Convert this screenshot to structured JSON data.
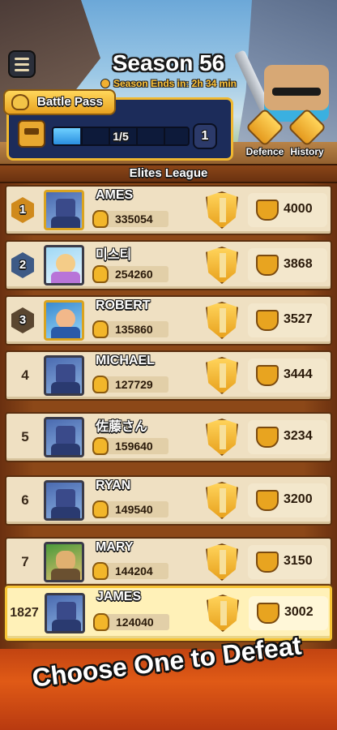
{
  "header": {
    "season_title": "Season 56",
    "season_ends": "Season Ends in: 2h 34 min",
    "menu_icon": "hamburger-menu-icon"
  },
  "battle_pass": {
    "label": "Battle Pass",
    "progress_text": "1/5",
    "progress_fraction": 0.2,
    "level": "1"
  },
  "side_buttons": {
    "defence": "Defence",
    "history": "History"
  },
  "league": {
    "title": "Elites League"
  },
  "rows": [
    {
      "rank": "1",
      "name": "AMES",
      "score": "335054",
      "trophies": "4000"
    },
    {
      "rank": "2",
      "name": "미스티",
      "score": "254260",
      "trophies": "3868"
    },
    {
      "rank": "3",
      "name": "ROBERT",
      "score": "135860",
      "trophies": "3527"
    },
    {
      "rank": "4",
      "name": "MICHAEL",
      "score": "127729",
      "trophies": "3444"
    },
    {
      "rank": "5",
      "name": "佐藤さん",
      "score": "159640",
      "trophies": "3234"
    },
    {
      "rank": "6",
      "name": "RYAN",
      "score": "149540",
      "trophies": "3200"
    },
    {
      "rank": "7",
      "name": "MARY",
      "score": "144204",
      "trophies": "3150"
    }
  ],
  "me": {
    "rank": "1827",
    "name": "JAMES",
    "score": "124040",
    "trophies": "3002"
  },
  "banner": {
    "text": "Choose One to Defeat"
  },
  "colors": {
    "gold": "#f0b830",
    "panel": "#1c2c5a",
    "row": "#efe0c2",
    "highlight_row": "#fff1b8",
    "banner": "#e05a16"
  }
}
